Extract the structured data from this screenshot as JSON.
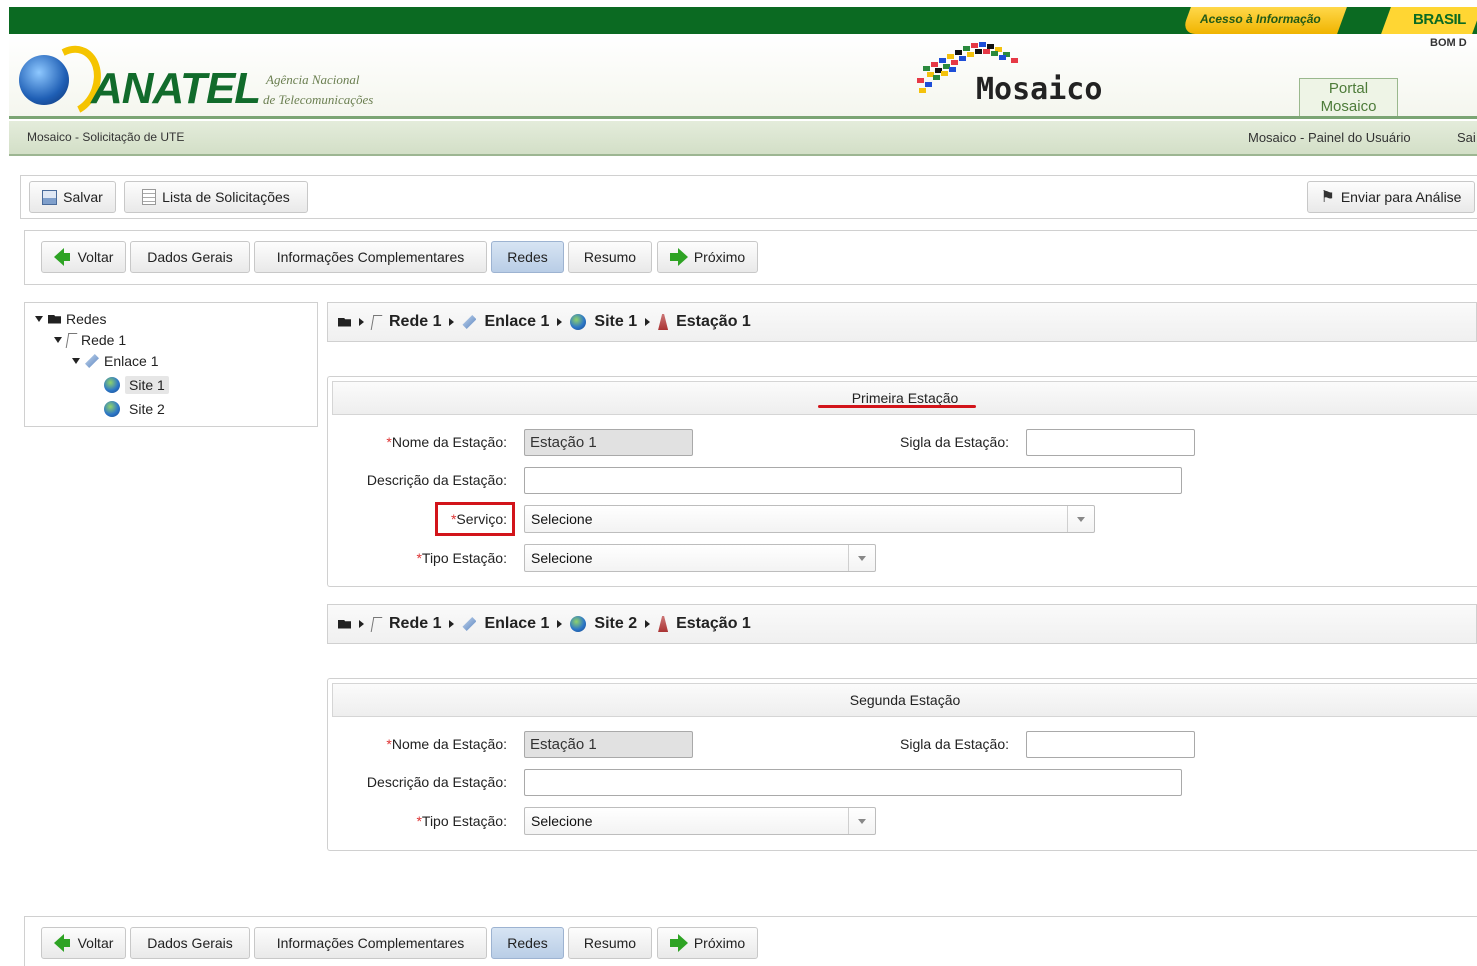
{
  "header": {
    "acesso_label": "Acesso à Informação",
    "brasil_label": "BRASIL",
    "bom_dia": "BOM D",
    "anatel_word": "ANATEL",
    "anatel_sub1": "Agência Nacional",
    "anatel_sub2": "de Telecomunicações",
    "mosaico_word": "Mosaico",
    "portal_line1": "Portal",
    "portal_line2": "Mosaico"
  },
  "subbar": {
    "left_label": "Mosaico - Solicitação de UTE",
    "right_label": "Mosaico - Painel do Usuário",
    "sair_label": "Sai"
  },
  "toolbar": {
    "save_label": "Salvar",
    "list_label": "Lista de Solicitações",
    "send_label": "Enviar para Análise"
  },
  "nav": {
    "back_label": "Voltar",
    "tabs": [
      "Dados Gerais",
      "Informações Complementares",
      "Redes",
      "Resumo"
    ],
    "next_label": "Próximo",
    "active_tab": "Redes"
  },
  "tree": {
    "root": "Redes",
    "rede": "Rede 1",
    "enlace": "Enlace 1",
    "sites": [
      "Site 1",
      "Site 2"
    ],
    "selected": "Site 1"
  },
  "crumbs": [
    {
      "rede": "Rede 1",
      "enlace": "Enlace 1",
      "site": "Site 1",
      "estacao": "Estação 1"
    },
    {
      "rede": "Rede 1",
      "enlace": "Enlace 1",
      "site": "Site 2",
      "estacao": "Estação 1"
    }
  ],
  "forms": [
    {
      "title": "Primeira Estação",
      "nome_label": "Nome da Estação:",
      "nome_value": "Estação 1",
      "sigla_label": "Sigla da Estação:",
      "sigla_value": "",
      "descricao_label": "Descrição da Estação:",
      "descricao_value": "",
      "servico_label": "Serviço:",
      "servico_value": "Selecione",
      "tipo_label": "Tipo Estação:",
      "tipo_value": "Selecione"
    },
    {
      "title": "Segunda Estação",
      "nome_label": "Nome da Estação:",
      "nome_value": "Estação 1",
      "sigla_label": "Sigla da Estação:",
      "sigla_value": "",
      "descricao_label": "Descrição da Estação:",
      "descricao_value": "",
      "tipo_label": "Tipo Estação:",
      "tipo_value": "Selecione"
    }
  ],
  "required_marker": "*",
  "colors": {
    "top_bar": "#0b6a22",
    "accent_yellow": "#f0b400",
    "highlight_red": "#d2141a",
    "active_tab": "#b9cde6"
  }
}
